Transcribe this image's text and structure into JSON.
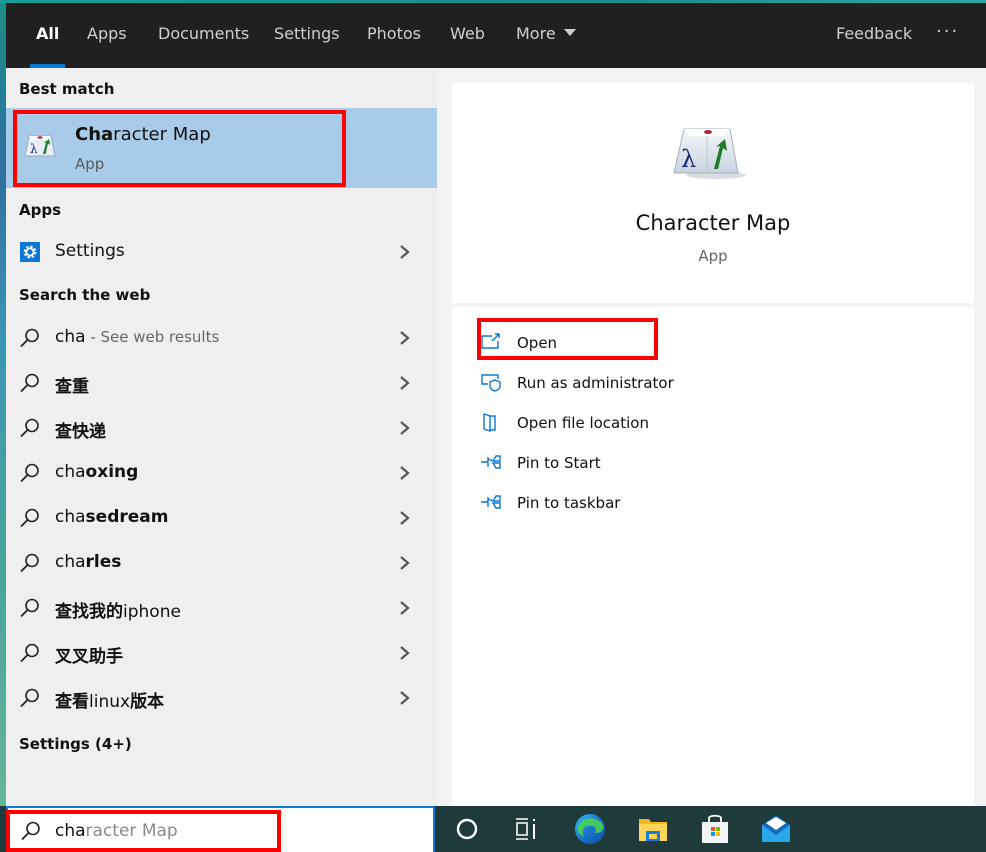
{
  "tabs": [
    {
      "label": "All",
      "active": true
    },
    {
      "label": "Apps"
    },
    {
      "label": "Documents"
    },
    {
      "label": "Settings"
    },
    {
      "label": "Photos"
    },
    {
      "label": "Web"
    },
    {
      "label": "More"
    }
  ],
  "header": {
    "feedback": "Feedback",
    "more_options": "···"
  },
  "best_match": {
    "section": "Best match",
    "title_typed": "Cha",
    "title_rest": "racter Map",
    "subtitle": "App",
    "icon": "character-map-icon"
  },
  "apps": {
    "section": "Apps",
    "items": [
      {
        "label": "Settings",
        "icon": "settings-gear-icon"
      }
    ]
  },
  "web": {
    "section": "Search the web",
    "items": [
      {
        "prefix": "cha",
        "bold": "",
        "suffix": " - See web results",
        "icon": "search-icon"
      },
      {
        "prefix": "",
        "bold": "查重",
        "suffix": "",
        "icon": "search-icon"
      },
      {
        "prefix": "",
        "bold": "查快递",
        "suffix": "",
        "icon": "search-icon"
      },
      {
        "prefix": "cha",
        "bold": "oxing",
        "suffix": "",
        "icon": "search-icon"
      },
      {
        "prefix": "cha",
        "bold": "sedream",
        "suffix": "",
        "icon": "search-icon"
      },
      {
        "prefix": "cha",
        "bold": "rles",
        "suffix": "",
        "icon": "search-icon"
      },
      {
        "prefix": "",
        "bold": "查找我的",
        "suffix": "iphone",
        "icon": "search-icon"
      },
      {
        "prefix": "",
        "bold": "叉叉助手",
        "suffix": "",
        "icon": "search-icon"
      },
      {
        "prefix": "",
        "bold": "查看",
        "mid": "linux",
        "bold2": "版本",
        "icon": "search-icon"
      }
    ]
  },
  "settings_more": {
    "section": "Settings (4+)"
  },
  "detail": {
    "title": "Character Map",
    "subtitle": "App",
    "actions": [
      {
        "label": "Open",
        "icon": "open-icon"
      },
      {
        "label": "Run as administrator",
        "icon": "shield-icon"
      },
      {
        "label": "Open file location",
        "icon": "file-location-icon"
      },
      {
        "label": "Pin to Start",
        "icon": "pin-icon"
      },
      {
        "label": "Pin to taskbar",
        "icon": "pin-icon"
      }
    ]
  },
  "search": {
    "typed": "cha",
    "autocomplete": "racter Map"
  },
  "taskbar": {
    "icons": [
      "cortana-icon",
      "task-view-icon",
      "edge-icon",
      "file-explorer-icon",
      "store-icon",
      "mail-icon"
    ]
  },
  "colors": {
    "accent": "#0a78d4",
    "highlight": "#ff0000",
    "selection": "#a9cbea"
  }
}
